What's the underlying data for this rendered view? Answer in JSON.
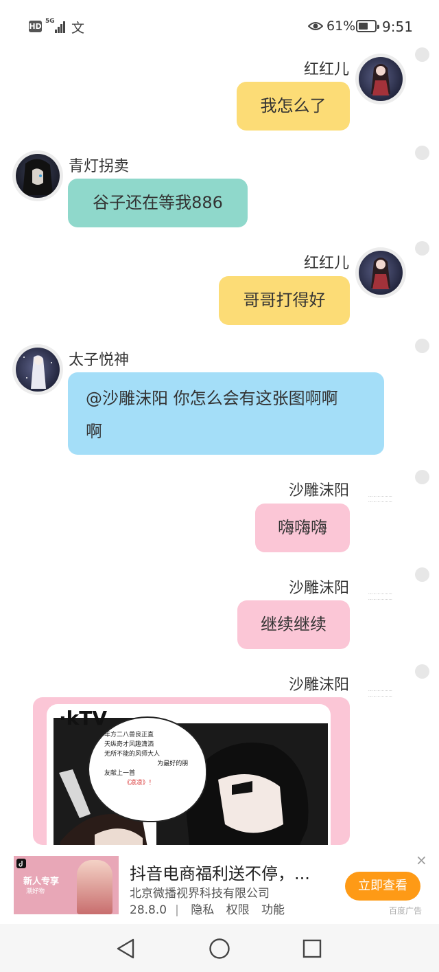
{
  "status_bar": {
    "hd": "HD",
    "network": "5G",
    "input_indicator": "文",
    "battery_percent": "61%",
    "battery_level": 0.61,
    "time": "9:51"
  },
  "messages": [
    {
      "side": "right",
      "name": "红红儿",
      "text": "我怎么了",
      "bubble_color": "#fcdc76"
    },
    {
      "side": "left",
      "name": "青灯拐卖",
      "text": "谷子还在等我886",
      "bubble_color": "#8fd8cb"
    },
    {
      "side": "right",
      "name": "红红儿",
      "text": "哥哥打得好",
      "bubble_color": "#fcdc76"
    },
    {
      "side": "left",
      "name": "太子悦神",
      "text_line1": "@沙雕沫阳 你怎么会有这张图啊啊",
      "text_line2": "啊",
      "bubble_color": "#a4def8"
    },
    {
      "side": "right",
      "name": "沙雕沫阳",
      "text": "嗨嗨嗨",
      "bubble_color": "#fbc6d6"
    },
    {
      "side": "right",
      "name": "沙雕沫阳",
      "text": "继续继续",
      "bubble_color": "#fbc6d6"
    },
    {
      "side": "right",
      "name": "沙雕沫阳",
      "image_caption": "KTV",
      "bubble_color": "#fbc6d6"
    }
  ],
  "image_card": {
    "ktv_label": "·kTV",
    "speech_line1": "年方二八兽良正直",
    "speech_line2": "天纵奇才风趣潇洒",
    "speech_line3": "无所不能的风师大人",
    "speech_line4": "为最好的朋",
    "speech_line5": "友献上一首",
    "speech_song": "《凉凉》！"
  },
  "ad": {
    "thumb_tag": "新人专享",
    "thumb_sub": "潮好物",
    "title": "抖音电商福利送不停，...",
    "company": "北京微播视界科技有限公司",
    "version": "28.8.0",
    "privacy": "隐私",
    "permissions": "权限",
    "features": "功能",
    "cta": "立即查看",
    "close": "×",
    "label": "百度广告"
  },
  "nav": {
    "back": "back-icon",
    "home": "home-icon",
    "recents": "recents-icon"
  }
}
